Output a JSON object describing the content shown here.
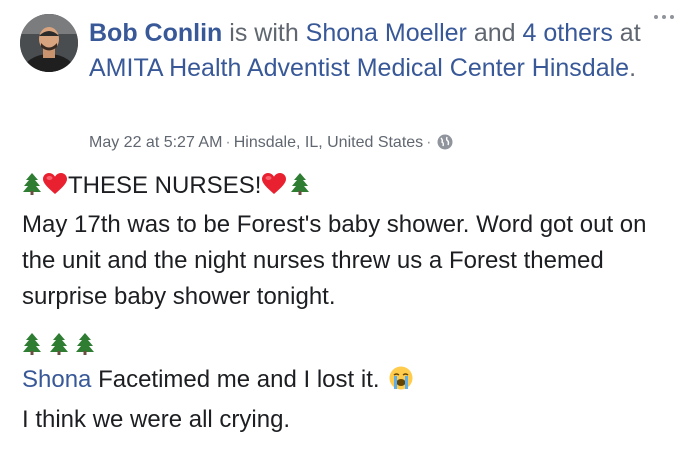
{
  "post": {
    "author": "Bob Conlin",
    "with_text": " is with ",
    "tagged_person": "Shona Moeller",
    "and_text": " and ",
    "others_link": "4 others",
    "at_text": " at ",
    "location_link": "AMITA Health Adventist Medical Center Hinsdale",
    "period": ".",
    "timestamp": "May 22 at 5:27 AM",
    "separator": "·",
    "place": "Hinsdale, IL, United States",
    "privacy_icon": "globe-icon",
    "more_icon": "more-options-icon",
    "body": {
      "headline": "THESE NURSES!",
      "paragraph": "May 17th was to be Forest's baby shower. Word got out on the unit and the night nurses threw us a Forest themed surprise baby shower tonight.",
      "mention": "Shona",
      "facetime_text": " Facetimed me and I lost it. ",
      "last_line": "I think we were all crying."
    },
    "emoji": {
      "tree": "evergreen-tree",
      "heart": "red-heart",
      "crying": "loudly-crying-face"
    },
    "colors": {
      "link": "#385898",
      "meta": "#616770",
      "text": "#1c1e21",
      "tree_green": "#2e7d32",
      "heart_red": "#e8202f"
    }
  }
}
